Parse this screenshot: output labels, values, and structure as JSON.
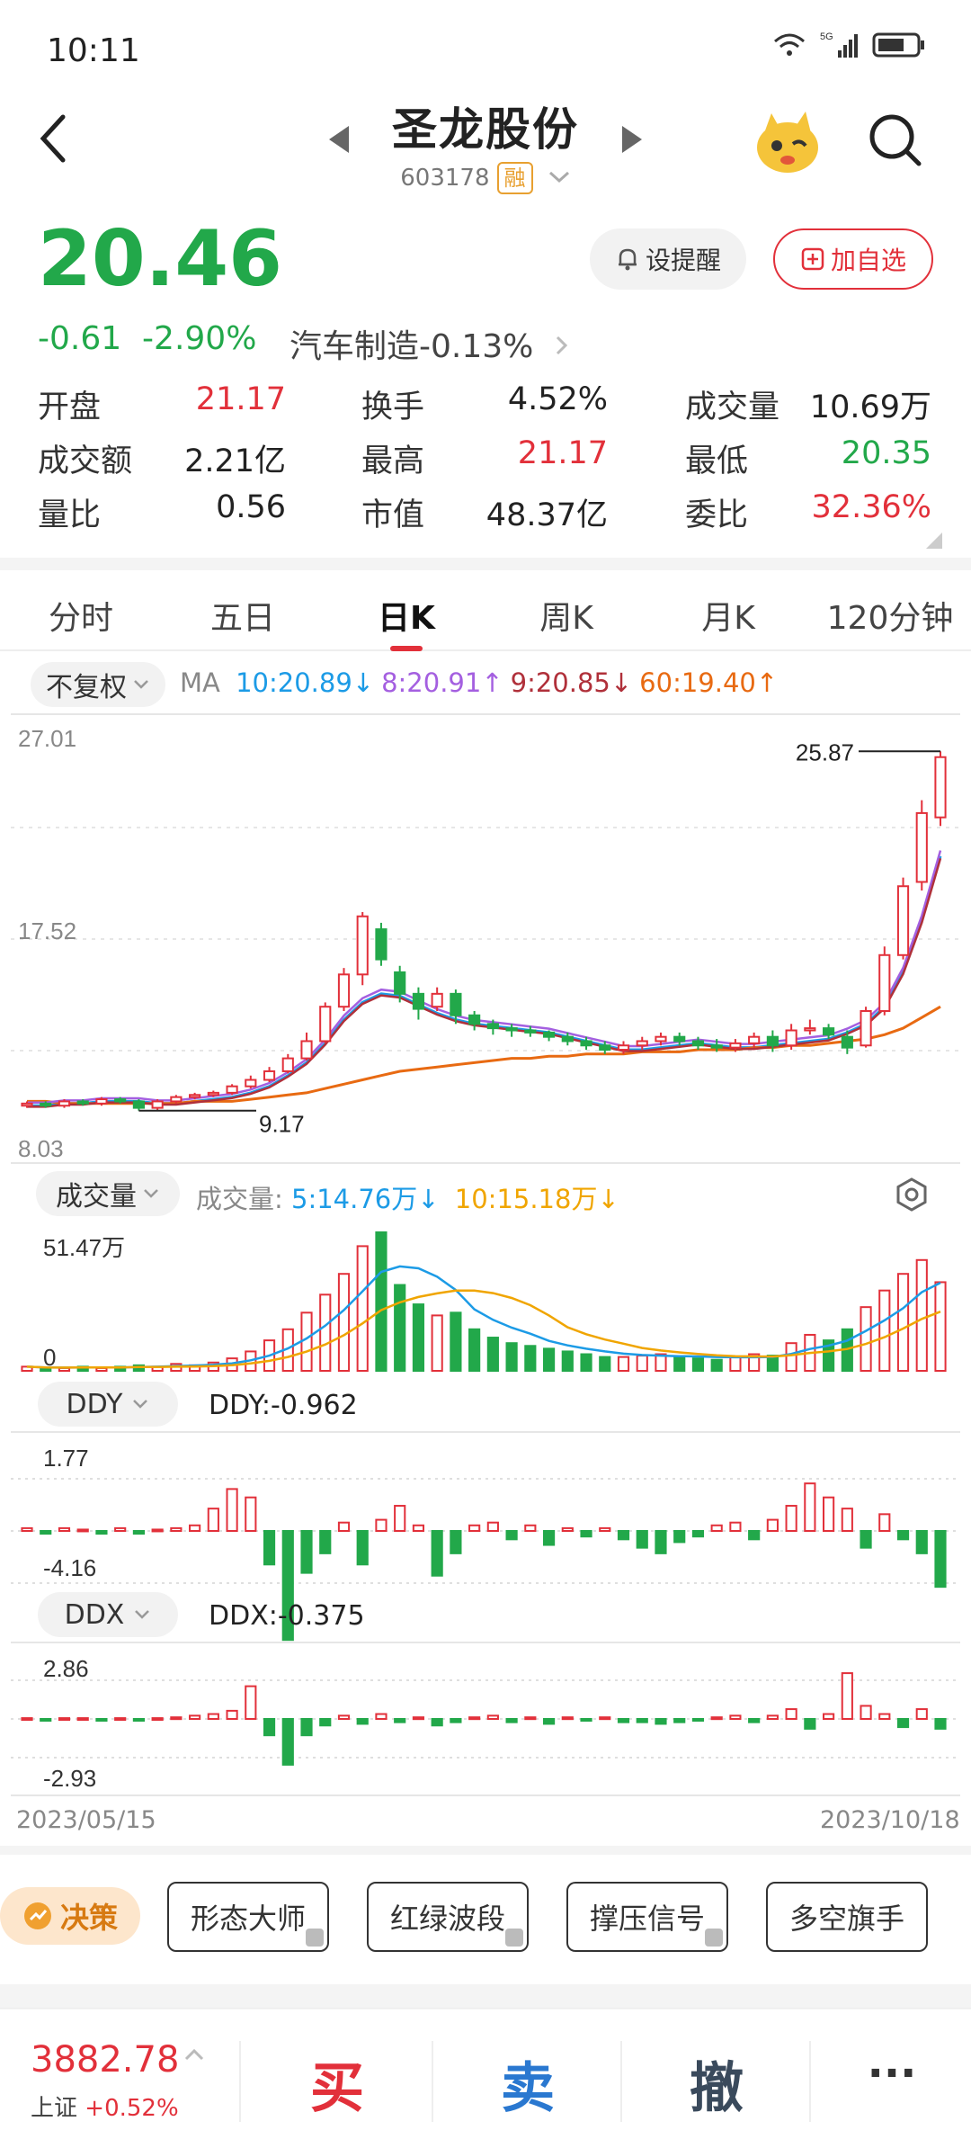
{
  "status": {
    "time": "10:11",
    "net": "5G"
  },
  "header": {
    "title": "圣龙股份",
    "code": "603178",
    "margin_tag": "融"
  },
  "quote": {
    "price": "20.46",
    "change": "-0.61",
    "change_pct": "-2.90%",
    "industry": "汽车制造",
    "industry_pct": "-0.13%",
    "alert_label": "设提醒",
    "add_label": "加自选"
  },
  "stats": [
    {
      "label": "开盘",
      "value": "21.17",
      "color": "red"
    },
    {
      "label": "换手",
      "value": "4.52%",
      "color": "dark"
    },
    {
      "label": "成交量",
      "value": "10.69万",
      "color": "dark"
    },
    {
      "label": "成交额",
      "value": "2.21亿",
      "color": "dark"
    },
    {
      "label": "最高",
      "value": "21.17",
      "color": "red"
    },
    {
      "label": "最低",
      "value": "20.35",
      "color": "green"
    },
    {
      "label": "量比",
      "value": "0.56",
      "color": "dark"
    },
    {
      "label": "市值",
      "value": "48.37亿",
      "color": "dark"
    },
    {
      "label": "委比",
      "value": "32.36%",
      "color": "red"
    }
  ],
  "tabs": [
    "分时",
    "五日",
    "日K",
    "周K",
    "月K",
    "120分钟"
  ],
  "active_tab": "日K",
  "ma": {
    "adjust": "不复权",
    "label": "MA",
    "items": [
      {
        "text": "10:20.89↓",
        "color": "#1c9be6"
      },
      {
        "text": "8:20.91↑",
        "color": "#a45fe0"
      },
      {
        "text": "9:20.85↓",
        "color": "#b0303a"
      },
      {
        "text": "60:19.40↑",
        "color": "#e86a12"
      }
    ]
  },
  "kline": {
    "y_top": "27.01",
    "y_mid": "17.52",
    "y_bot": "8.03",
    "high_label": "25.87",
    "low_label": "9.17"
  },
  "volume": {
    "selector": "成交量",
    "label": "成交量:",
    "ma5": "5:14.76万↓",
    "ma10": "10:15.18万↓",
    "y_top": "51.47万",
    "y_bot": "0"
  },
  "ddy": {
    "selector": "DDY",
    "value": "DDY:-0.962",
    "y_top": "1.77",
    "y_bot": "-4.16"
  },
  "ddx": {
    "selector": "DDX",
    "value": "DDX:-0.375",
    "y_top": "2.86",
    "y_bot": "-2.93"
  },
  "dates": {
    "start": "2023/05/15",
    "end": "2023/10/18"
  },
  "tools": {
    "juece": "决策",
    "items": [
      "形态大师",
      "红绿波段",
      "撑压信号",
      "多空旗手"
    ]
  },
  "bottom": {
    "index_value": "3882.78",
    "index_name": "上证",
    "index_pct": "+0.52%",
    "buy": "买",
    "sell": "卖",
    "cancel": "撤",
    "more": "···"
  },
  "colors": {
    "up": "#e2303a",
    "down": "#22a84a",
    "ma5": "#1c9be6",
    "ma10": "#f0a500",
    "ma60": "#e86a12"
  },
  "chart_data": {
    "type": "candlestick",
    "xlabel_range": [
      "2023/05/15",
      "2023/10/18"
    ],
    "ylim": [
      8.03,
      27.01
    ],
    "series": [
      {
        "name": "MA10",
        "values": [
          9.4,
          9.4,
          9.5,
          9.5,
          9.6,
          9.6,
          9.6,
          9.5,
          9.5,
          9.6,
          9.7,
          9.8,
          10.0,
          10.3,
          10.8,
          11.4,
          12.3,
          13.4,
          14.2,
          14.6,
          14.5,
          14.1,
          13.7,
          13.4,
          13.2,
          13.1,
          13.0,
          12.9,
          12.8,
          12.6,
          12.4,
          12.2,
          12.0,
          12.0,
          12.1,
          12.2,
          12.3,
          12.2,
          12.1,
          12.1,
          12.2,
          12.3,
          12.4,
          12.5,
          12.8,
          13.2,
          14.0,
          15.6,
          18.0,
          21.0
        ]
      },
      {
        "name": "MA60",
        "values": [
          9.6,
          9.6,
          9.5,
          9.5,
          9.5,
          9.5,
          9.5,
          9.5,
          9.5,
          9.6,
          9.6,
          9.6,
          9.7,
          9.8,
          9.9,
          10.0,
          10.2,
          10.4,
          10.6,
          10.8,
          11.0,
          11.1,
          11.2,
          11.3,
          11.4,
          11.5,
          11.6,
          11.6,
          11.7,
          11.7,
          11.8,
          11.8,
          11.8,
          11.9,
          11.9,
          11.9,
          12.0,
          12.0,
          12.0,
          12.1,
          12.1,
          12.2,
          12.2,
          12.3,
          12.4,
          12.5,
          12.7,
          13.0,
          13.5,
          14.0
        ]
      }
    ],
    "candles": [
      [
        9.4,
        9.5,
        9.3,
        9.6
      ],
      [
        9.5,
        9.4,
        9.3,
        9.6
      ],
      [
        9.4,
        9.6,
        9.3,
        9.7
      ],
      [
        9.6,
        9.5,
        9.4,
        9.7
      ],
      [
        9.5,
        9.7,
        9.4,
        9.8
      ],
      [
        9.7,
        9.6,
        9.5,
        9.8
      ],
      [
        9.6,
        9.3,
        9.17,
        9.7
      ],
      [
        9.3,
        9.6,
        9.2,
        9.7
      ],
      [
        9.6,
        9.8,
        9.5,
        9.9
      ],
      [
        9.8,
        9.9,
        9.7,
        10.0
      ],
      [
        9.9,
        10.0,
        9.8,
        10.1
      ],
      [
        10.0,
        10.3,
        9.9,
        10.4
      ],
      [
        10.3,
        10.6,
        10.2,
        10.8
      ],
      [
        10.6,
        11.0,
        10.5,
        11.2
      ],
      [
        11.0,
        11.6,
        10.9,
        11.8
      ],
      [
        11.6,
        12.4,
        11.5,
        12.8
      ],
      [
        12.4,
        14.0,
        12.3,
        14.2
      ],
      [
        14.0,
        15.5,
        13.8,
        15.8
      ],
      [
        15.5,
        18.2,
        15.0,
        18.4
      ],
      [
        17.6,
        16.2,
        15.9,
        17.9
      ],
      [
        15.6,
        14.6,
        14.2,
        15.9
      ],
      [
        14.6,
        13.9,
        13.4,
        14.9
      ],
      [
        14.0,
        14.6,
        13.8,
        14.9
      ],
      [
        14.6,
        13.6,
        13.2,
        14.8
      ],
      [
        13.6,
        13.2,
        12.9,
        13.8
      ],
      [
        13.2,
        13.0,
        12.7,
        13.4
      ],
      [
        13.0,
        12.9,
        12.6,
        13.2
      ],
      [
        12.9,
        12.8,
        12.6,
        13.1
      ],
      [
        12.8,
        12.6,
        12.4,
        12.9
      ],
      [
        12.6,
        12.4,
        12.2,
        12.8
      ],
      [
        12.4,
        12.2,
        12.0,
        12.6
      ],
      [
        12.2,
        12.0,
        11.8,
        12.4
      ],
      [
        12.0,
        12.2,
        11.8,
        12.4
      ],
      [
        12.2,
        12.4,
        12.0,
        12.6
      ],
      [
        12.4,
        12.6,
        12.2,
        12.8
      ],
      [
        12.6,
        12.4,
        12.2,
        12.8
      ],
      [
        12.4,
        12.2,
        12.0,
        12.6
      ],
      [
        12.2,
        12.1,
        11.9,
        12.5
      ],
      [
        12.1,
        12.3,
        11.9,
        12.5
      ],
      [
        12.3,
        12.6,
        12.1,
        12.8
      ],
      [
        12.6,
        12.2,
        11.9,
        12.9
      ],
      [
        12.2,
        12.9,
        12.0,
        13.2
      ],
      [
        12.9,
        13.0,
        12.7,
        13.4
      ],
      [
        13.0,
        12.7,
        12.5,
        13.2
      ],
      [
        12.6,
        12.1,
        11.8,
        12.9
      ],
      [
        12.2,
        13.8,
        12.1,
        14.0
      ],
      [
        13.8,
        16.4,
        13.6,
        16.8
      ],
      [
        16.4,
        19.6,
        16.2,
        20.0
      ],
      [
        19.8,
        23.0,
        19.4,
        23.6
      ],
      [
        22.8,
        25.6,
        22.4,
        25.87
      ]
    ],
    "high": 25.87,
    "low": 9.17
  }
}
